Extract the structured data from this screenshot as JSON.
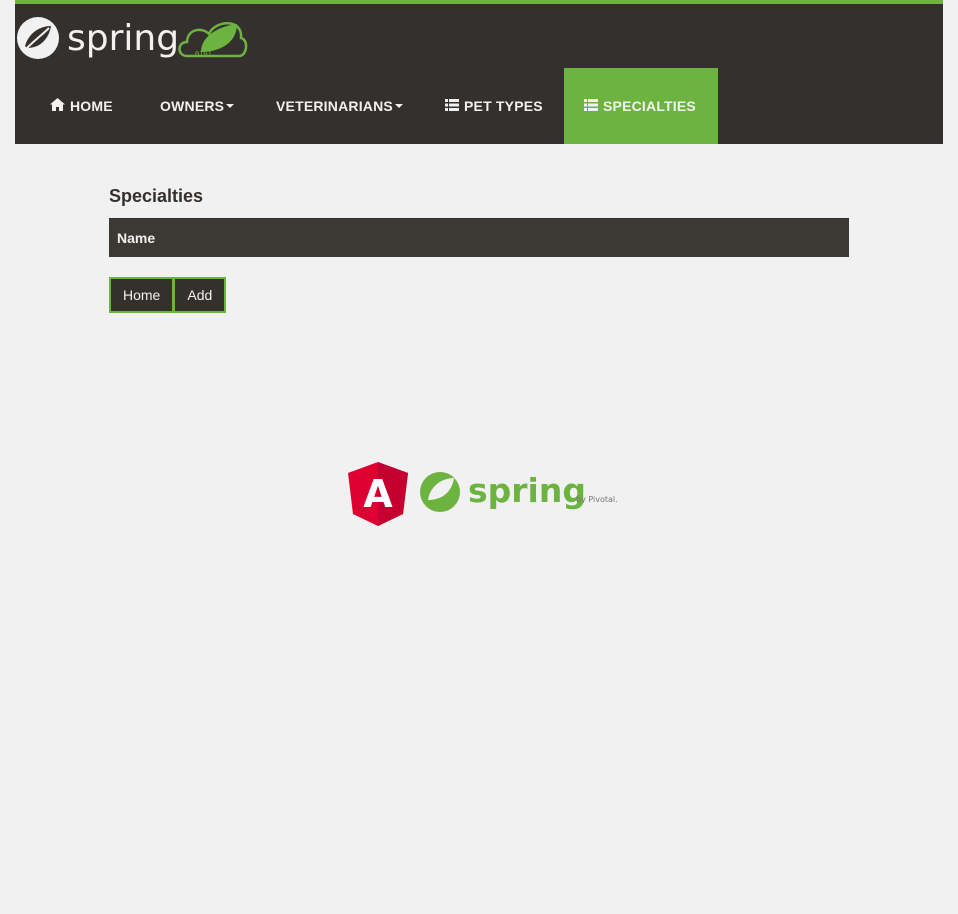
{
  "brand": {
    "logo_text": "spring",
    "leaf_digits": "0101"
  },
  "nav": {
    "home": {
      "label": "HOME",
      "icon": "home-icon"
    },
    "owners": {
      "label": "OWNERS"
    },
    "veterinarians": {
      "label": "VETERINARIANS"
    },
    "pet_types": {
      "label": "PET TYPES",
      "icon": "list-icon"
    },
    "specialties": {
      "label": "SPECIALTIES",
      "icon": "list-icon",
      "active": true
    }
  },
  "page": {
    "title": "Specialties",
    "table": {
      "columns": [
        "Name"
      ],
      "rows": []
    },
    "buttons": {
      "home": "Home",
      "add": "Add"
    }
  },
  "footer": {
    "angular_letter": "A",
    "spring_text": "spring",
    "by_pivotal": "by Pivotal."
  },
  "colors": {
    "accent_green": "#6db33f",
    "dark": "#34302d",
    "background": "#f1f1f1",
    "angular_red": "#dd0031"
  }
}
